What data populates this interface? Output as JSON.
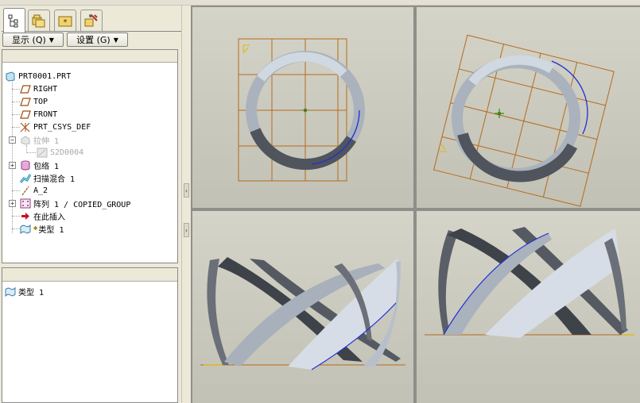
{
  "left_panel": {
    "tabs": [
      {
        "icon": "model-tree-icon"
      },
      {
        "icon": "folder-browser-icon"
      },
      {
        "icon": "favorites-icon"
      },
      {
        "icon": "connections-icon"
      }
    ],
    "show_button": "显示 (Q)",
    "settings_button": "设置 (G)",
    "tree": [
      {
        "label": "PRT0001.PRT",
        "icon": "part-icon"
      },
      {
        "label": "RIGHT",
        "icon": "datum-plane-icon"
      },
      {
        "label": "TOP",
        "icon": "datum-plane-icon"
      },
      {
        "label": "FRONT",
        "icon": "datum-plane-icon"
      },
      {
        "label": "PRT_CSYS_DEF",
        "icon": "csys-icon"
      },
      {
        "label": "拉伸 1",
        "icon": "extrude-icon",
        "suppressed": true
      },
      {
        "label": "S2D0004",
        "icon": "sketch-icon",
        "suppressed": true
      },
      {
        "label": "包络 1",
        "icon": "wrap-icon"
      },
      {
        "label": "扫描混合 1",
        "icon": "swept-blend-icon"
      },
      {
        "label": "A_2",
        "icon": "datum-axis-icon"
      },
      {
        "label": "阵列 1 / COPIED_GROUP",
        "icon": "pattern-icon"
      },
      {
        "label": "在此插入",
        "icon": "insert-here-icon"
      },
      {
        "label": "类型 1",
        "icon": "surface-icon"
      }
    ],
    "bottom_list": [
      {
        "label": "类型 1",
        "icon": "surface-icon"
      }
    ]
  },
  "splitter": {
    "grips": [
      {
        "icon": "collapse-left-icon",
        "glyph": "‹"
      },
      {
        "icon": "expand-right-icon",
        "glyph": "›"
      }
    ]
  },
  "viewports": [
    {
      "name": "top-view",
      "view": "top"
    },
    {
      "name": "trimetric-view",
      "view": "rotated-top"
    },
    {
      "name": "front-view",
      "view": "front"
    },
    {
      "name": "side-view",
      "view": "side"
    }
  ],
  "colors": {
    "window_bg": "#ece9d8",
    "viewport_bg": "#d0cfc3",
    "grid": "#b56b1e",
    "edge_highlight": "#1f2fd6",
    "surface_light": "#c8d0dc",
    "surface_dark": "#4c5058"
  }
}
